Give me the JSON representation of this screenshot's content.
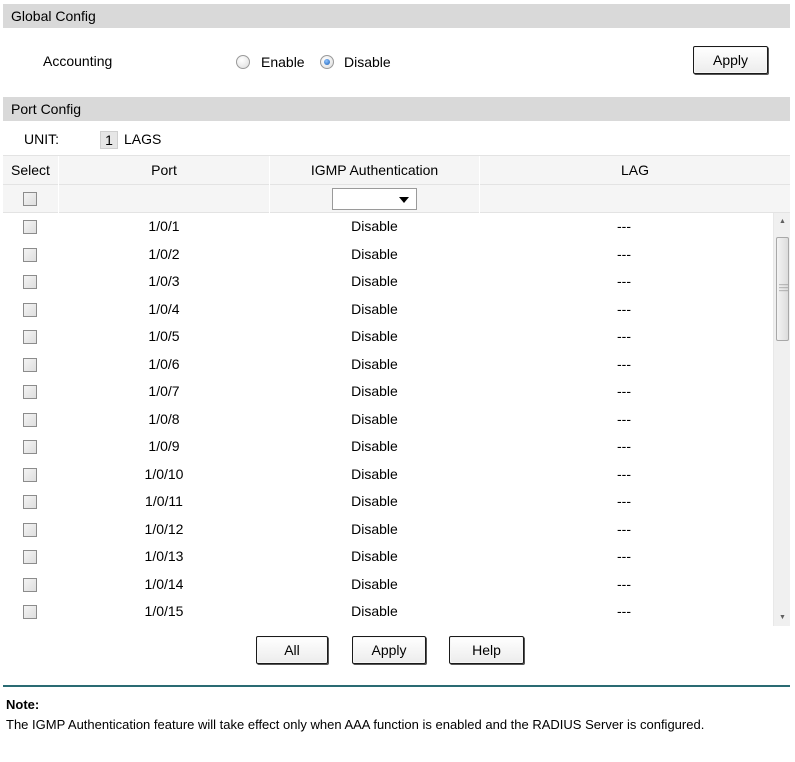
{
  "global_config": {
    "title": "Global Config",
    "accounting_label": "Accounting",
    "options": [
      "Enable",
      "Disable"
    ],
    "selected": "Disable",
    "apply_label": "Apply"
  },
  "port_config": {
    "title": "Port Config",
    "unit_label": "UNIT:",
    "unit_value": "1",
    "lags_label": "LAGS",
    "columns": [
      "Select",
      "Port",
      "IGMP Authentication",
      "LAG"
    ],
    "filter_value": "",
    "rows": [
      {
        "port": "1/0/1",
        "auth": "Disable",
        "lag": "---"
      },
      {
        "port": "1/0/2",
        "auth": "Disable",
        "lag": "---"
      },
      {
        "port": "1/0/3",
        "auth": "Disable",
        "lag": "---"
      },
      {
        "port": "1/0/4",
        "auth": "Disable",
        "lag": "---"
      },
      {
        "port": "1/0/5",
        "auth": "Disable",
        "lag": "---"
      },
      {
        "port": "1/0/6",
        "auth": "Disable",
        "lag": "---"
      },
      {
        "port": "1/0/7",
        "auth": "Disable",
        "lag": "---"
      },
      {
        "port": "1/0/8",
        "auth": "Disable",
        "lag": "---"
      },
      {
        "port": "1/0/9",
        "auth": "Disable",
        "lag": "---"
      },
      {
        "port": "1/0/10",
        "auth": "Disable",
        "lag": "---"
      },
      {
        "port": "1/0/11",
        "auth": "Disable",
        "lag": "---"
      },
      {
        "port": "1/0/12",
        "auth": "Disable",
        "lag": "---"
      },
      {
        "port": "1/0/13",
        "auth": "Disable",
        "lag": "---"
      },
      {
        "port": "1/0/14",
        "auth": "Disable",
        "lag": "---"
      },
      {
        "port": "1/0/15",
        "auth": "Disable",
        "lag": "---"
      }
    ],
    "buttons": {
      "all": "All",
      "apply": "Apply",
      "help": "Help"
    }
  },
  "note": {
    "title": "Note:",
    "text": "The IGMP Authentication feature will take effect only when AAA function is enabled and the RADIUS Server is configured."
  },
  "colors": {
    "header_bg": "#d9d9d9",
    "row_alt": "#f5f5f5",
    "note_rule": "#2a6b73",
    "radio_selected": "#1a5fb4"
  }
}
